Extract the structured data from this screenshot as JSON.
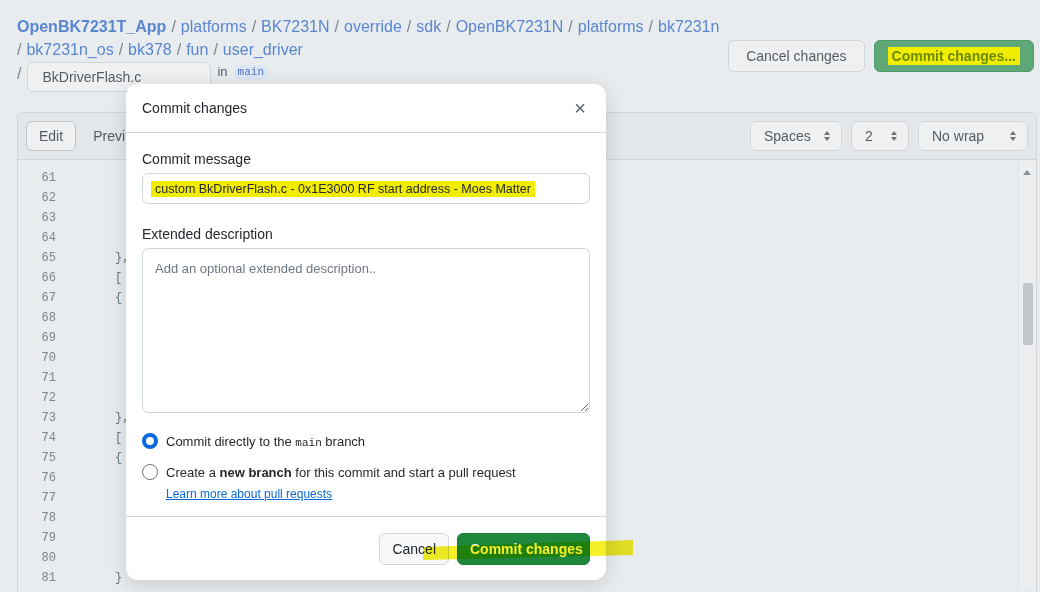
{
  "breadcrumb_rows": [
    {
      "items": [
        {
          "label": "OpenBK7231T_App",
          "kind": "repo"
        },
        {
          "sep": "/",
          "label": "platforms"
        },
        {
          "sep": "/",
          "label": "BK7231N"
        },
        {
          "sep": "/",
          "label": "override"
        },
        {
          "sep": "/",
          "label": "sdk"
        },
        {
          "sep": "/",
          "label": "OpenBK7231N"
        },
        {
          "sep": "/",
          "label": "platforms"
        },
        {
          "sep": "/",
          "label": "bk7231n"
        }
      ]
    },
    {
      "items": [
        {
          "sep": "/",
          "label": "bk7231n_os"
        },
        {
          "sep": "/",
          "label": "bk378"
        },
        {
          "sep": "/",
          "label": "fun"
        },
        {
          "sep": "/",
          "label": "user_driver"
        }
      ]
    }
  ],
  "filename": {
    "sep": "/",
    "value": "BkDriverFlash.c",
    "in_label": "in",
    "branch": "main"
  },
  "header_buttons": [
    {
      "label": "Cancel changes",
      "kind": "default",
      "highlighted": false
    },
    {
      "label": "Commit changes...",
      "kind": "primary",
      "highlighted": true
    }
  ],
  "editor": {
    "tabs": [
      {
        "label": "Edit",
        "selected": true
      },
      {
        "label": "Previ",
        "selected": false
      }
    ],
    "selects": [
      "Spaces",
      "2",
      "No wrap"
    ],
    "lines": [
      {
        "number": "61"
      },
      {
        "number": "62"
      },
      {
        "number": "63"
      },
      {
        "number": "64"
      },
      {
        "number": "65",
        "code": "},"
      },
      {
        "number": "66",
        "code": "["
      },
      {
        "number": "67",
        "code": "{"
      },
      {
        "number": "68"
      },
      {
        "number": "69"
      },
      {
        "number": "70"
      },
      {
        "number": "71"
      },
      {
        "number": "72"
      },
      {
        "number": "73",
        "code": "},"
      },
      {
        "number": "74",
        "code": "["
      },
      {
        "number": "75",
        "code": "{"
      },
      {
        "number": "76"
      },
      {
        "number": "77"
      },
      {
        "number": "78"
      },
      {
        "number": "79"
      },
      {
        "number": "80"
      },
      {
        "number": "81",
        "code": "}"
      }
    ]
  },
  "dialog": {
    "title": "Commit changes",
    "close": "×",
    "message_label": "Commit message",
    "message": {
      "value": "custom BkDriverFlash.c - 0x1E3000 RF start address - Moes Matter",
      "highlighted": true
    },
    "description_label": "Extended description",
    "description": {
      "placeholder": "Add an optional extended description.."
    },
    "options": [
      {
        "selected": true,
        "parts": [
          {
            "text": "Commit directly to the "
          },
          {
            "text": "main",
            "kind": "code"
          },
          {
            "text": " branch"
          }
        ]
      },
      {
        "selected": false,
        "parts": [
          {
            "text": "Create a "
          },
          {
            "text": "new branch",
            "kind": "bold"
          },
          {
            "text": " for this commit and start a pull request "
          }
        ],
        "link": "Learn more about pull requests"
      }
    ],
    "buttons": [
      {
        "label": "Cancel",
        "kind": "default"
      },
      {
        "label": "Commit changes",
        "kind": "primary"
      }
    ],
    "footer_highlight": true
  }
}
